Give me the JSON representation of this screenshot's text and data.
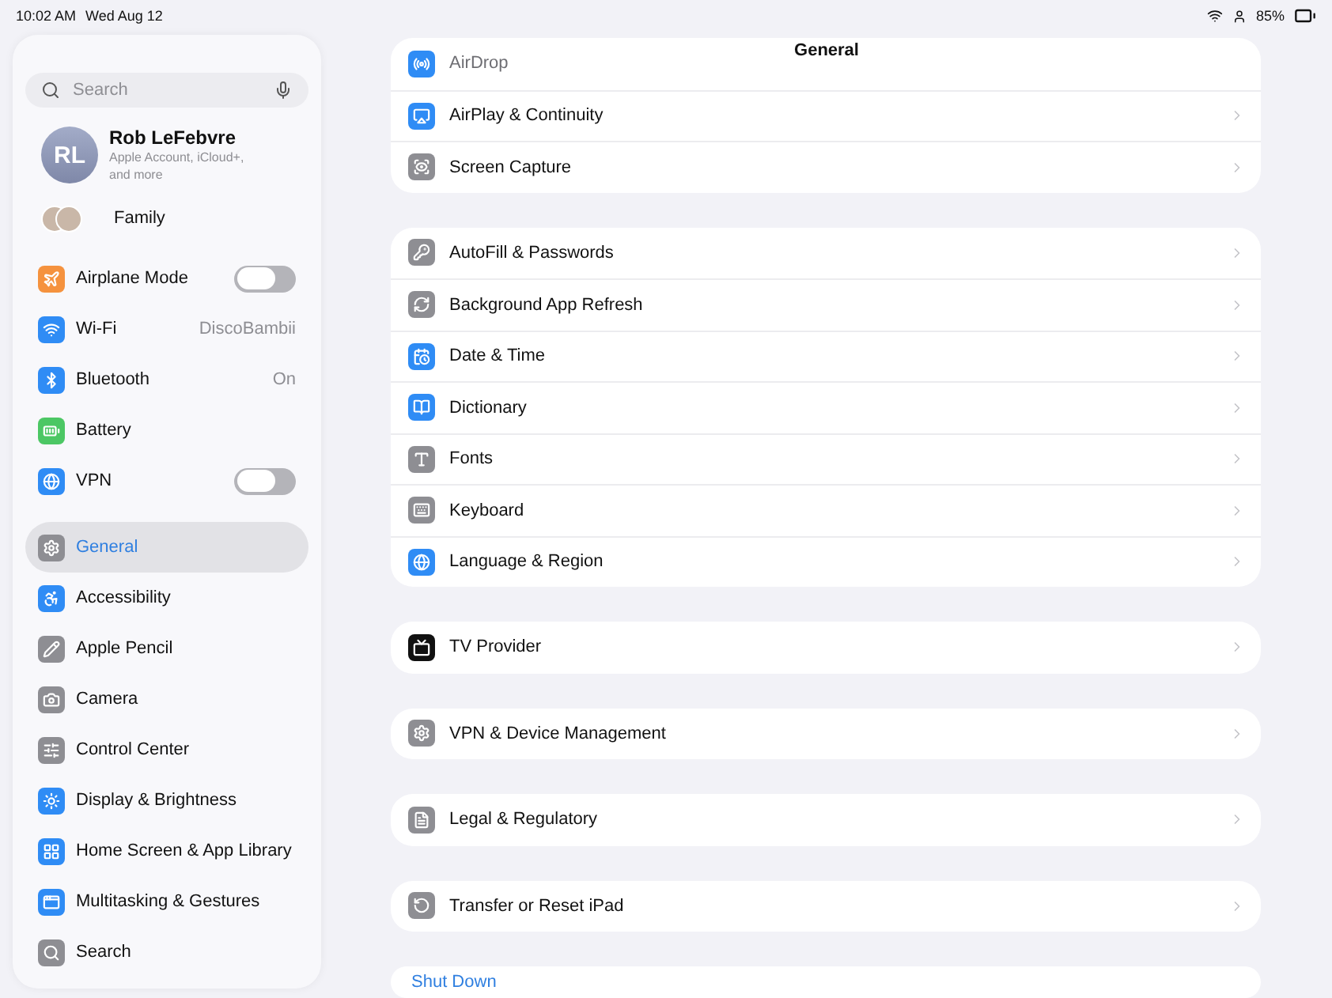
{
  "status_bar": {
    "time": "10:02 AM",
    "date": "Wed Aug 12",
    "battery": "85%"
  },
  "sidebar": {
    "search": {
      "placeholder": "Search"
    },
    "profile": {
      "initials": "RL",
      "name": "Rob LeFebvre",
      "subtitle": "Apple Account, iCloud+, and more"
    },
    "family": {
      "label": "Family"
    },
    "groups": [
      {
        "items": [
          {
            "label": "Airplane Mode",
            "kind": "toggle",
            "on": false,
            "selected": false,
            "color": "#f5923e"
          },
          {
            "label": "Wi-Fi",
            "kind": "value",
            "value": "DiscoBambii",
            "selected": false,
            "color": "#2f8cf5"
          },
          {
            "label": "Bluetooth",
            "kind": "value",
            "value": "On",
            "selected": false,
            "color": "#2f8cf5"
          },
          {
            "label": "Battery",
            "kind": "link",
            "selected": false,
            "color": "#4cc764"
          },
          {
            "label": "VPN",
            "kind": "toggle",
            "on": false,
            "selected": false,
            "color": "#2f8cf5"
          }
        ]
      },
      {
        "items": [
          {
            "label": "General",
            "kind": "link",
            "selected": true,
            "color": "#8e8e93"
          },
          {
            "label": "Accessibility",
            "kind": "link",
            "selected": false,
            "color": "#2f8cf5"
          },
          {
            "label": "Apple Pencil",
            "kind": "link",
            "selected": false,
            "color": "#8e8e93"
          },
          {
            "label": "Camera",
            "kind": "link",
            "selected": false,
            "color": "#8e8e93"
          },
          {
            "label": "Control Center",
            "kind": "link",
            "selected": false,
            "color": "#8e8e93"
          },
          {
            "label": "Display & Brightness",
            "kind": "link",
            "selected": false,
            "color": "#2f8cf5"
          },
          {
            "label": "Home Screen & App Library",
            "kind": "link",
            "selected": false,
            "color": "#2f8cf5"
          },
          {
            "label": "Multitasking & Gestures",
            "kind": "link",
            "selected": false,
            "color": "#2f8cf5"
          },
          {
            "label": "Search",
            "kind": "link",
            "selected": false,
            "color": "#8e8e93"
          }
        ]
      }
    ]
  },
  "main": {
    "title": "General",
    "groups": [
      {
        "rows": [
          {
            "label": "AirDrop",
            "kind": "obscured",
            "color": "#2f8cf5"
          },
          {
            "label": "AirPlay & Continuity",
            "kind": "link",
            "color": "#2f8cf5"
          },
          {
            "label": "Screen Capture",
            "kind": "link",
            "color": "#8e8e93"
          }
        ]
      },
      {
        "rows": [
          {
            "label": "AutoFill & Passwords",
            "kind": "link",
            "color": "#8e8e93"
          },
          {
            "label": "Background App Refresh",
            "kind": "link",
            "color": "#8e8e93"
          },
          {
            "label": "Date & Time",
            "kind": "link",
            "color": "#2f8cf5"
          },
          {
            "label": "Dictionary",
            "kind": "link",
            "color": "#2f8cf5"
          },
          {
            "label": "Fonts",
            "kind": "link",
            "color": "#8e8e93"
          },
          {
            "label": "Keyboard",
            "kind": "link",
            "color": "#8e8e93"
          },
          {
            "label": "Language & Region",
            "kind": "link",
            "color": "#2f8cf5"
          }
        ]
      },
      {
        "rows": [
          {
            "label": "TV Provider",
            "kind": "link",
            "color": "#111111"
          }
        ]
      },
      {
        "rows": [
          {
            "label": "VPN & Device Management",
            "kind": "link",
            "color": "#8e8e93"
          }
        ]
      },
      {
        "rows": [
          {
            "label": "Legal & Regulatory",
            "kind": "link",
            "color": "#8e8e93"
          }
        ]
      },
      {
        "rows": [
          {
            "label": "Transfer or Reset iPad",
            "kind": "link",
            "color": "#8e8e93"
          }
        ]
      }
    ],
    "shut_down": {
      "label": "Shut Down"
    }
  }
}
